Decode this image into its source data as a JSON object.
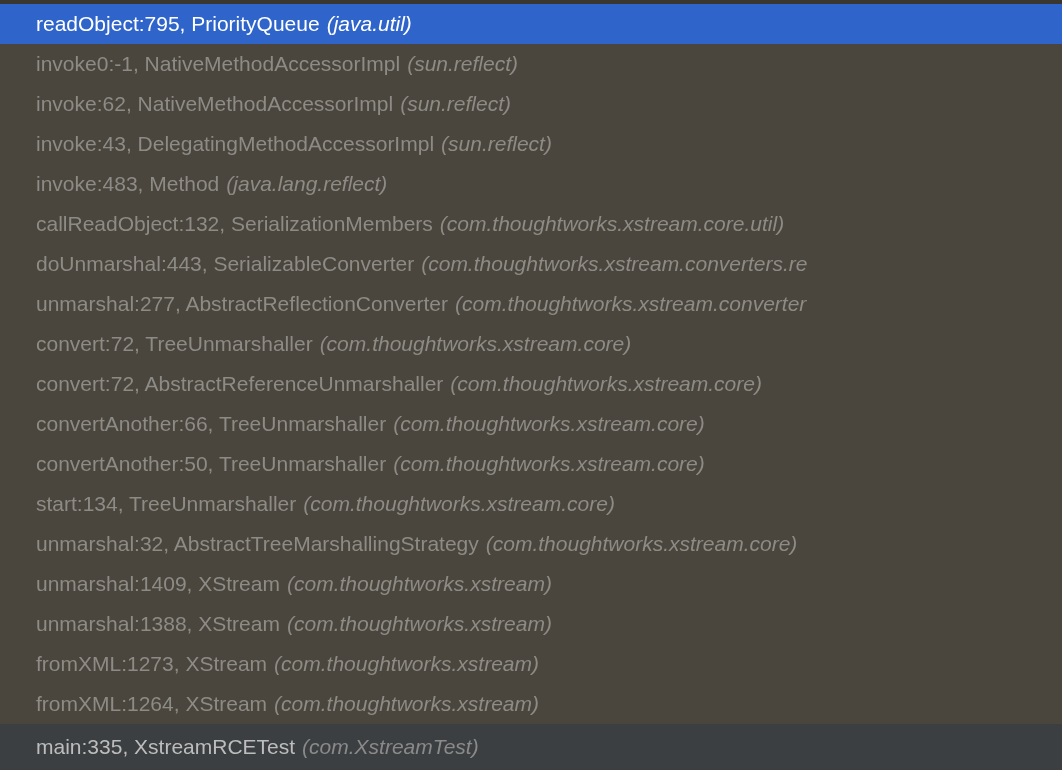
{
  "frames": [
    {
      "method": "readObject:795, PriorityQueue",
      "package": "(java.util)",
      "selected": true,
      "kind": "library"
    },
    {
      "method": "invoke0:-1, NativeMethodAccessorImpl",
      "package": "(sun.reflect)",
      "selected": false,
      "kind": "library"
    },
    {
      "method": "invoke:62, NativeMethodAccessorImpl",
      "package": "(sun.reflect)",
      "selected": false,
      "kind": "library"
    },
    {
      "method": "invoke:43, DelegatingMethodAccessorImpl",
      "package": "(sun.reflect)",
      "selected": false,
      "kind": "library"
    },
    {
      "method": "invoke:483, Method",
      "package": "(java.lang.reflect)",
      "selected": false,
      "kind": "library"
    },
    {
      "method": "callReadObject:132, SerializationMembers",
      "package": "(com.thoughtworks.xstream.core.util)",
      "selected": false,
      "kind": "library"
    },
    {
      "method": "doUnmarshal:443, SerializableConverter",
      "package": "(com.thoughtworks.xstream.converters.re",
      "selected": false,
      "kind": "library"
    },
    {
      "method": "unmarshal:277, AbstractReflectionConverter",
      "package": "(com.thoughtworks.xstream.converter",
      "selected": false,
      "kind": "library"
    },
    {
      "method": "convert:72, TreeUnmarshaller",
      "package": "(com.thoughtworks.xstream.core)",
      "selected": false,
      "kind": "library"
    },
    {
      "method": "convert:72, AbstractReferenceUnmarshaller",
      "package": "(com.thoughtworks.xstream.core)",
      "selected": false,
      "kind": "library"
    },
    {
      "method": "convertAnother:66, TreeUnmarshaller",
      "package": "(com.thoughtworks.xstream.core)",
      "selected": false,
      "kind": "library"
    },
    {
      "method": "convertAnother:50, TreeUnmarshaller",
      "package": "(com.thoughtworks.xstream.core)",
      "selected": false,
      "kind": "library"
    },
    {
      "method": "start:134, TreeUnmarshaller",
      "package": "(com.thoughtworks.xstream.core)",
      "selected": false,
      "kind": "library"
    },
    {
      "method": "unmarshal:32, AbstractTreeMarshallingStrategy",
      "package": "(com.thoughtworks.xstream.core)",
      "selected": false,
      "kind": "library"
    },
    {
      "method": "unmarshal:1409, XStream",
      "package": "(com.thoughtworks.xstream)",
      "selected": false,
      "kind": "library"
    },
    {
      "method": "unmarshal:1388, XStream",
      "package": "(com.thoughtworks.xstream)",
      "selected": false,
      "kind": "library"
    },
    {
      "method": "fromXML:1273, XStream",
      "package": "(com.thoughtworks.xstream)",
      "selected": false,
      "kind": "library"
    },
    {
      "method": "fromXML:1264, XStream",
      "package": "(com.thoughtworks.xstream)",
      "selected": false,
      "kind": "library"
    },
    {
      "method": "main:335, XstreamRCETest",
      "package": "(com.XstreamTest)",
      "selected": false,
      "kind": "project"
    }
  ]
}
